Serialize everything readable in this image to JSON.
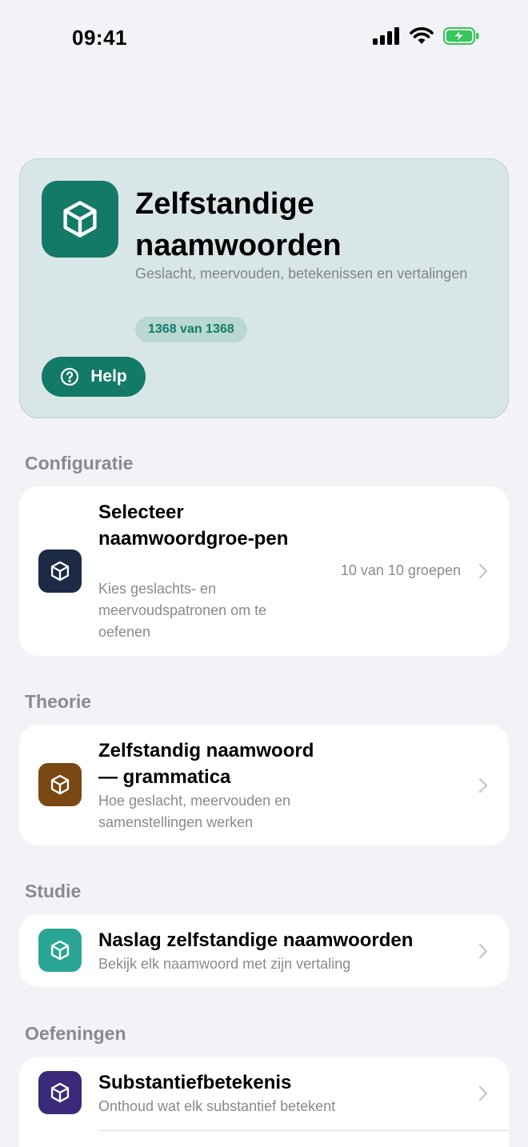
{
  "status": {
    "time": "09:41"
  },
  "hero": {
    "title": "Zelfstandige naamwoorden",
    "subtitle": "Geslacht, meervouden, betekenissen en vertalingen",
    "badge": "1368 van 1368",
    "help_label": "Help",
    "accent": "#127a66"
  },
  "sections": {
    "configuratie": {
      "title": "Configuratie",
      "item": {
        "title": "Selecteer naamwoordgroe-pen",
        "subtitle": "Kies geslachts- en meervoudspatronen om te oefenen",
        "value": "10 van 10 groepen",
        "icon": "cube-icon",
        "color": "#1c2a45"
      }
    },
    "theorie": {
      "title": "Theorie",
      "item": {
        "title": "Zelfstandig naamwoord — grammatica",
        "subtitle": "Hoe geslacht, meervouden en samenstellingen werken",
        "icon": "cube-icon",
        "color": "#7a4812"
      }
    },
    "studie": {
      "title": "Studie",
      "item": {
        "title": "Naslag zelfstandige naamwoorden",
        "subtitle": "Bekijk elk naamwoord met zijn vertaling",
        "icon": "cube-icon",
        "color": "#2aa595"
      }
    },
    "oefeningen": {
      "title": "Oefeningen",
      "item": {
        "title": "Substantiefbetekenis",
        "subtitle": "Onthoud wat elk substantief betekent",
        "icon": "cube-icon",
        "color": "#3b2a7a"
      }
    }
  }
}
